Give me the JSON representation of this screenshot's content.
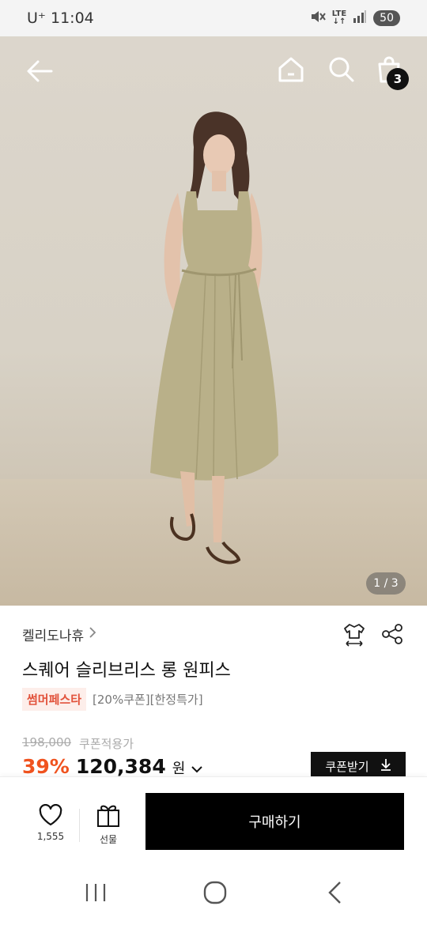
{
  "status_bar": {
    "carrier": "U⁺",
    "time": "11:04",
    "network": "LTE",
    "battery": "50",
    "icons": [
      "mute-icon",
      "lte-icon",
      "signal-icon",
      "battery-icon"
    ]
  },
  "header": {
    "icons": [
      "back-arrow-icon",
      "home-icon",
      "search-icon",
      "shopping-bag-icon"
    ],
    "cart_count": "3"
  },
  "gallery": {
    "indicator": "1 / 3"
  },
  "product": {
    "brand": "켈리도나휴",
    "title": "스퀘어 슬리브리스 롱 원피스",
    "tag": "썸머페스타",
    "tag_text": "[20%쿠폰][한정특가]",
    "original_price": "198,000",
    "coupon_label": "쿠폰적용가",
    "discount": "39%",
    "price": "120,384",
    "currency": "원",
    "coupon_button": "쿠폰받기"
  },
  "actions": {
    "like_count": "1,555",
    "gift_label": "선물",
    "buy_label": "구매하기"
  },
  "colors": {
    "accent": "#f0531f",
    "tag_text": "#e2533c",
    "tag_bg": "#fdeeea",
    "dark": "#000000"
  }
}
